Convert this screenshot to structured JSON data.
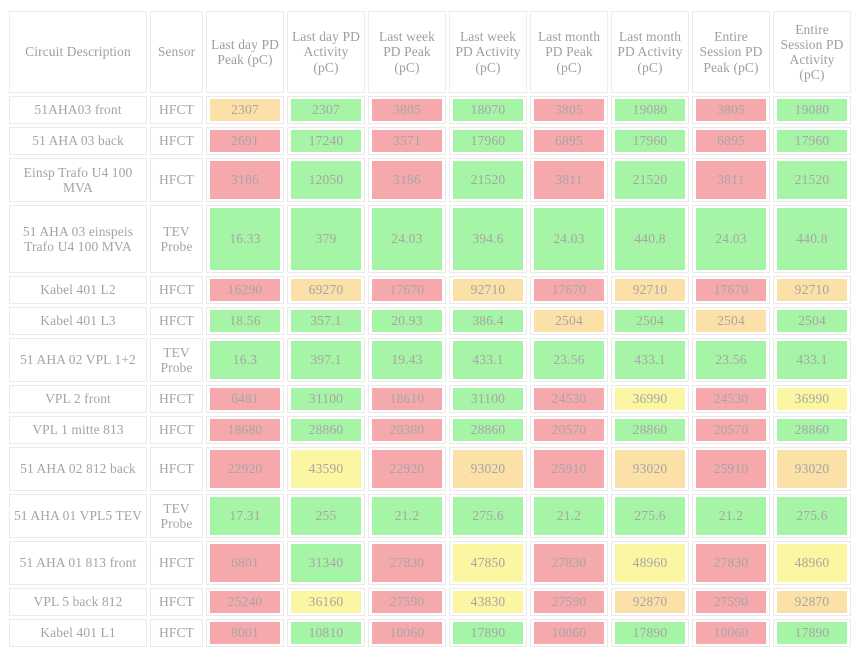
{
  "table": {
    "columns": [
      {
        "key": "description",
        "label": "Circuit Description"
      },
      {
        "key": "sensor",
        "label": "Sensor"
      },
      {
        "key": "last_day_peak",
        "label": "Last day PD Peak (pC)"
      },
      {
        "key": "last_day_activity",
        "label": "Last day PD Activity (pC)"
      },
      {
        "key": "last_week_peak",
        "label": "Last week PD Peak (pC)"
      },
      {
        "key": "last_week_activity",
        "label": "Last week PD Activity (pC)"
      },
      {
        "key": "last_month_peak",
        "label": "Last month PD Peak (pC)"
      },
      {
        "key": "last_month_activity",
        "label": "Last month PD Activity (pC)"
      },
      {
        "key": "session_peak",
        "label": "Entire Session PD Peak (pC)"
      },
      {
        "key": "session_activity",
        "label": "Entire Session PD Activity (pC)"
      }
    ],
    "colors": {
      "green": "#a6f4a6",
      "red": "#f6a9ad",
      "orange": "#fbe0a8",
      "yellow": "#fbf6a2",
      "text": "#a8a5a5",
      "border": "#ececec",
      "background": "#ffffff"
    },
    "rows": [
      {
        "description": "51AHA03 front",
        "sensor": "HFCT",
        "values": [
          {
            "text": "2307",
            "color": "orange"
          },
          {
            "text": "2307",
            "color": "green"
          },
          {
            "text": "3805",
            "color": "red"
          },
          {
            "text": "18070",
            "color": "green"
          },
          {
            "text": "3805",
            "color": "red"
          },
          {
            "text": "19080",
            "color": "green"
          },
          {
            "text": "3805",
            "color": "red"
          },
          {
            "text": "19080",
            "color": "green"
          }
        ]
      },
      {
        "description": "51 AHA 03 back",
        "sensor": "HFCT",
        "values": [
          {
            "text": "2691",
            "color": "red"
          },
          {
            "text": "17240",
            "color": "green"
          },
          {
            "text": "3571",
            "color": "red"
          },
          {
            "text": "17960",
            "color": "green"
          },
          {
            "text": "6895",
            "color": "red"
          },
          {
            "text": "17960",
            "color": "green"
          },
          {
            "text": "6895",
            "color": "red"
          },
          {
            "text": "17960",
            "color": "green"
          }
        ]
      },
      {
        "description": "Einsp Trafo U4 100 MVA",
        "sensor": "HFCT",
        "values": [
          {
            "text": "3186",
            "color": "red"
          },
          {
            "text": "12050",
            "color": "green"
          },
          {
            "text": "3186",
            "color": "red"
          },
          {
            "text": "21520",
            "color": "green"
          },
          {
            "text": "3811",
            "color": "red"
          },
          {
            "text": "21520",
            "color": "green"
          },
          {
            "text": "3811",
            "color": "red"
          },
          {
            "text": "21520",
            "color": "green"
          }
        ]
      },
      {
        "description": "51 AHA 03 einspeis Trafo U4 100 MVA",
        "sensor": "TEV Probe",
        "values": [
          {
            "text": "16.33",
            "color": "green"
          },
          {
            "text": "379",
            "color": "green"
          },
          {
            "text": "24.03",
            "color": "green"
          },
          {
            "text": "394.6",
            "color": "green"
          },
          {
            "text": "24.03",
            "color": "green"
          },
          {
            "text": "440.8",
            "color": "green"
          },
          {
            "text": "24.03",
            "color": "green"
          },
          {
            "text": "440.8",
            "color": "green"
          }
        ]
      },
      {
        "description": "Kabel 401 L2",
        "sensor": "HFCT",
        "values": [
          {
            "text": "16290",
            "color": "red"
          },
          {
            "text": "69270",
            "color": "orange"
          },
          {
            "text": "17670",
            "color": "red"
          },
          {
            "text": "92710",
            "color": "orange"
          },
          {
            "text": "17670",
            "color": "red"
          },
          {
            "text": "92710",
            "color": "orange"
          },
          {
            "text": "17670",
            "color": "red"
          },
          {
            "text": "92710",
            "color": "orange"
          }
        ]
      },
      {
        "description": "Kabel 401 L3",
        "sensor": "HFCT",
        "values": [
          {
            "text": "18.56",
            "color": "green"
          },
          {
            "text": "357.1",
            "color": "green"
          },
          {
            "text": "20.93",
            "color": "green"
          },
          {
            "text": "386.4",
            "color": "green"
          },
          {
            "text": "2504",
            "color": "orange"
          },
          {
            "text": "2504",
            "color": "green"
          },
          {
            "text": "2504",
            "color": "orange"
          },
          {
            "text": "2504",
            "color": "green"
          }
        ]
      },
      {
        "description": "51 AHA 02 VPL 1+2",
        "sensor": "TEV Probe",
        "values": [
          {
            "text": "16.3",
            "color": "green"
          },
          {
            "text": "397.1",
            "color": "green"
          },
          {
            "text": "19.43",
            "color": "green"
          },
          {
            "text": "433.1",
            "color": "green"
          },
          {
            "text": "23.56",
            "color": "green"
          },
          {
            "text": "433.1",
            "color": "green"
          },
          {
            "text": "23.56",
            "color": "green"
          },
          {
            "text": "433.1",
            "color": "green"
          }
        ]
      },
      {
        "description": "VPL 2 front",
        "sensor": "HFCT",
        "values": [
          {
            "text": "6481",
            "color": "red"
          },
          {
            "text": "31100",
            "color": "green"
          },
          {
            "text": "18610",
            "color": "red"
          },
          {
            "text": "31100",
            "color": "green"
          },
          {
            "text": "24530",
            "color": "red"
          },
          {
            "text": "36990",
            "color": "yellow"
          },
          {
            "text": "24530",
            "color": "red"
          },
          {
            "text": "36990",
            "color": "yellow"
          }
        ]
      },
      {
        "description": "VPL 1 mitte 813",
        "sensor": "HFCT",
        "values": [
          {
            "text": "18680",
            "color": "red"
          },
          {
            "text": "28860",
            "color": "green"
          },
          {
            "text": "20380",
            "color": "red"
          },
          {
            "text": "28860",
            "color": "green"
          },
          {
            "text": "20570",
            "color": "red"
          },
          {
            "text": "28860",
            "color": "green"
          },
          {
            "text": "20570",
            "color": "red"
          },
          {
            "text": "28860",
            "color": "green"
          }
        ]
      },
      {
        "description": "51 AHA 02 812 back",
        "sensor": "HFCT",
        "values": [
          {
            "text": "22920",
            "color": "red"
          },
          {
            "text": "43590",
            "color": "yellow"
          },
          {
            "text": "22920",
            "color": "red"
          },
          {
            "text": "93020",
            "color": "orange"
          },
          {
            "text": "25910",
            "color": "red"
          },
          {
            "text": "93020",
            "color": "orange"
          },
          {
            "text": "25910",
            "color": "red"
          },
          {
            "text": "93020",
            "color": "orange"
          }
        ]
      },
      {
        "description": "51 AHA 01 VPL5 TEV",
        "sensor": "TEV Probe",
        "values": [
          {
            "text": "17.31",
            "color": "green"
          },
          {
            "text": "255",
            "color": "green"
          },
          {
            "text": "21.2",
            "color": "green"
          },
          {
            "text": "275.6",
            "color": "green"
          },
          {
            "text": "21.2",
            "color": "green"
          },
          {
            "text": "275.6",
            "color": "green"
          },
          {
            "text": "21.2",
            "color": "green"
          },
          {
            "text": "275.6",
            "color": "green"
          }
        ]
      },
      {
        "description": "51 AHA 01 813 front",
        "sensor": "HFCT",
        "values": [
          {
            "text": "6801",
            "color": "red"
          },
          {
            "text": "31340",
            "color": "green"
          },
          {
            "text": "27830",
            "color": "red"
          },
          {
            "text": "47850",
            "color": "yellow"
          },
          {
            "text": "27830",
            "color": "red"
          },
          {
            "text": "48960",
            "color": "yellow"
          },
          {
            "text": "27830",
            "color": "red"
          },
          {
            "text": "48960",
            "color": "yellow"
          }
        ]
      },
      {
        "description": "VPL 5 back 812",
        "sensor": "HFCT",
        "values": [
          {
            "text": "25240",
            "color": "red"
          },
          {
            "text": "36160",
            "color": "yellow"
          },
          {
            "text": "27590",
            "color": "red"
          },
          {
            "text": "43830",
            "color": "yellow"
          },
          {
            "text": "27590",
            "color": "red"
          },
          {
            "text": "92870",
            "color": "orange"
          },
          {
            "text": "27590",
            "color": "red"
          },
          {
            "text": "92870",
            "color": "orange"
          }
        ]
      },
      {
        "description": "Kabel 401 L1",
        "sensor": "HFCT",
        "values": [
          {
            "text": "8001",
            "color": "red"
          },
          {
            "text": "10810",
            "color": "green"
          },
          {
            "text": "10060",
            "color": "red"
          },
          {
            "text": "17890",
            "color": "green"
          },
          {
            "text": "10060",
            "color": "red"
          },
          {
            "text": "17890",
            "color": "green"
          },
          {
            "text": "10060",
            "color": "red"
          },
          {
            "text": "17890",
            "color": "green"
          }
        ]
      }
    ]
  }
}
